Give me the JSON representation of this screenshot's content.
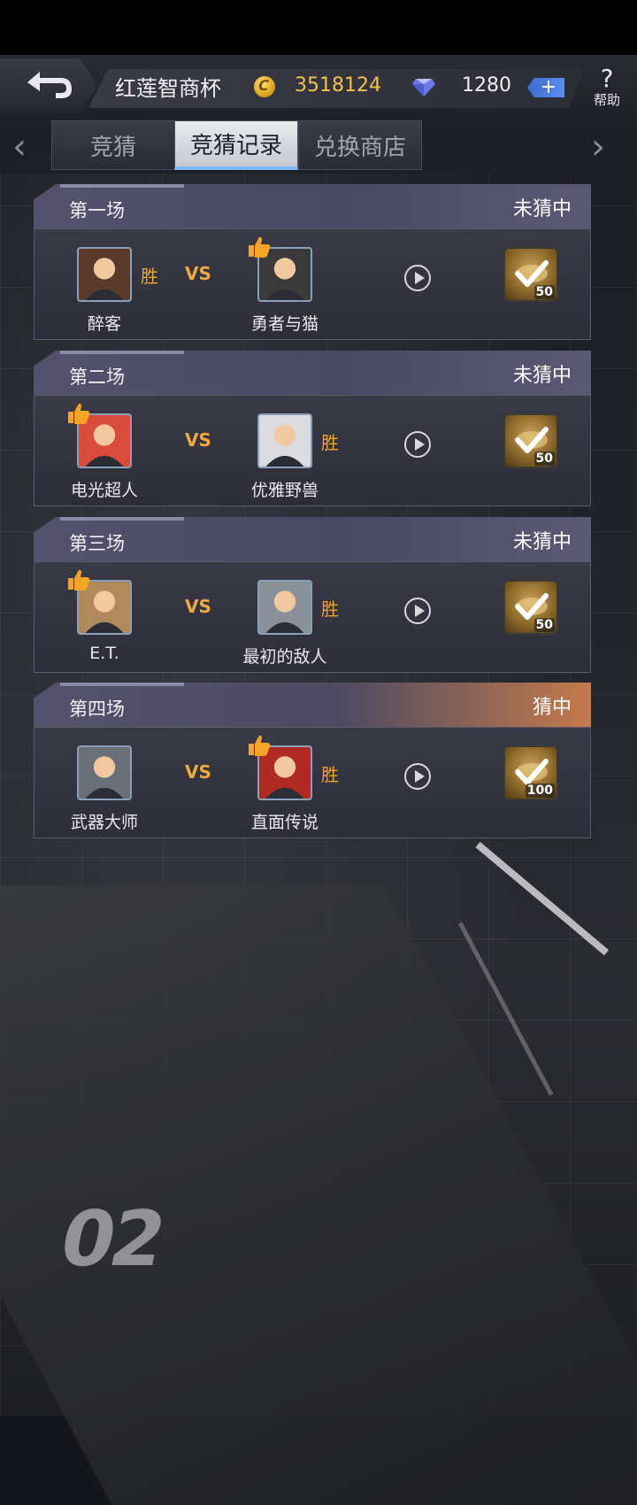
{
  "header": {
    "title": "红莲智商杯",
    "coins": "3518124",
    "gems": "1280",
    "plus": "+",
    "help_glyph": "?",
    "help_label": "帮助"
  },
  "tabs": [
    {
      "label": "竞猜",
      "active": false
    },
    {
      "label": "竞猜记录",
      "active": true
    },
    {
      "label": "兑换商店",
      "active": false
    }
  ],
  "nav": {
    "left": "‹",
    "right": "›"
  },
  "matches": [
    {
      "round": "第一场",
      "result": "未猜中",
      "vs": "VS",
      "left": {
        "name": "醉客",
        "win_tag": "胜",
        "avatar_color": "#5a3a2a"
      },
      "right": {
        "name": "勇者与猫",
        "win_tag": "",
        "avatar_color": "#3a3a3a"
      },
      "reward_amount": "50",
      "thumb_on": "right",
      "win_label": "胜"
    },
    {
      "round": "第二场",
      "result": "未猜中",
      "vs": "VS",
      "left": {
        "name": "电光超人",
        "win_tag": "",
        "avatar_color": "#d94b3a"
      },
      "right": {
        "name": "优雅野兽",
        "win_tag": "胜",
        "avatar_color": "#dcdce0"
      },
      "reward_amount": "50",
      "thumb_on": "left",
      "win_label": "胜"
    },
    {
      "round": "第三场",
      "result": "未猜中",
      "vs": "VS",
      "left": {
        "name": "E.T.",
        "win_tag": "",
        "avatar_color": "#b08a5a"
      },
      "right": {
        "name": "最初的敌人",
        "win_tag": "胜",
        "avatar_color": "#8a9098"
      },
      "reward_amount": "50",
      "thumb_on": "left",
      "win_label": "胜"
    },
    {
      "round": "第四场",
      "result": "猜中",
      "vs": "VS",
      "left": {
        "name": "武器大师",
        "win_tag": "",
        "avatar_color": "#6a6f78"
      },
      "right": {
        "name": "直面传说",
        "win_tag": "胜",
        "avatar_color": "#b02a24"
      },
      "reward_amount": "100",
      "thumb_on": "right",
      "win_label": "胜"
    }
  ],
  "background_mark": "02",
  "colors": {
    "accent_gold": "#f3c24a",
    "win_orange": "#f5a525",
    "tab_highlight": "#7fb8ff"
  }
}
